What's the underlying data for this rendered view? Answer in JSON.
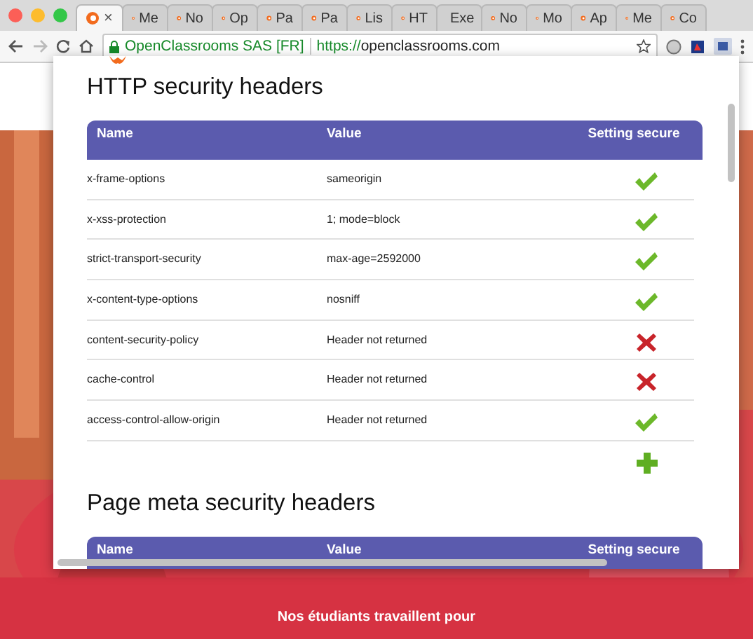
{
  "browser": {
    "tabs": [
      {
        "selected": true,
        "close": "×"
      },
      {
        "label": "Me",
        "selected": false
      },
      {
        "label": "No",
        "selected": false
      },
      {
        "label": "Op",
        "selected": false
      },
      {
        "label": "Pa",
        "selected": false
      },
      {
        "label": "Pa",
        "selected": false
      },
      {
        "label": "Lis",
        "selected": false
      },
      {
        "label": "HT",
        "selected": false
      },
      {
        "label": "Exe",
        "selected": false
      },
      {
        "label": "No",
        "selected": false
      },
      {
        "label": "Mo",
        "selected": false
      },
      {
        "label": "Ap",
        "selected": false
      },
      {
        "label": "Me",
        "selected": false
      },
      {
        "label": "Co",
        "selected": false
      }
    ],
    "address": {
      "organization": "OpenClassrooms SAS [FR]",
      "scheme": "https://",
      "host": "openclassrooms.com"
    }
  },
  "popup": {
    "sections": [
      {
        "title": "HTTP security headers",
        "columns": [
          "Name",
          "Value",
          "Setting secure"
        ],
        "rows": [
          {
            "kind": "header",
            "name": "x-frame-options",
            "value": "sameorigin",
            "secure": true
          },
          {
            "kind": "header",
            "name": "x-xss-protection",
            "value": "1; mode=block",
            "secure": true
          },
          {
            "kind": "header",
            "name": "strict-transport-security",
            "value": "max-age=2592000",
            "secure": true
          },
          {
            "kind": "header",
            "name": "x-content-type-options",
            "value": "nosniff",
            "secure": true
          },
          {
            "kind": "header",
            "name": "content-security-policy",
            "value": "Header not returned",
            "secure": false
          },
          {
            "kind": "header",
            "name": "cache-control",
            "value": "Header not returned",
            "secure": false
          },
          {
            "kind": "header",
            "name": "access-control-allow-origin",
            "value": "Header not returned",
            "secure": true
          },
          {
            "kind": "add"
          }
        ]
      },
      {
        "title": "Page meta security headers",
        "columns": [
          "Name",
          "Value",
          "Setting secure"
        ]
      }
    ]
  },
  "page": {
    "banner_text": "Nos étudiants travaillent pour"
  }
}
